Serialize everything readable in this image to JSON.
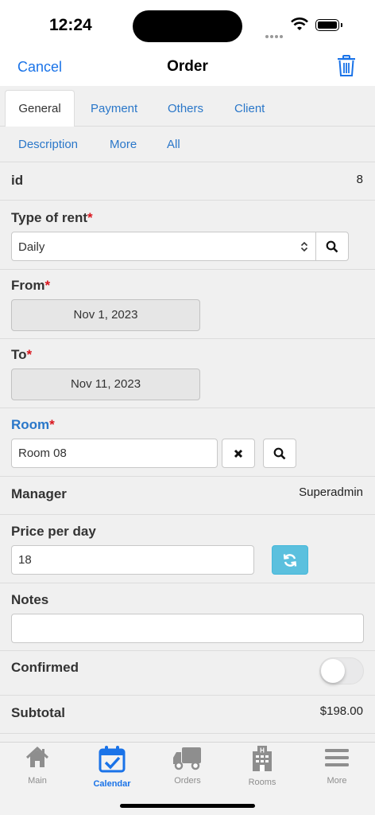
{
  "status_bar": {
    "time": "12:24"
  },
  "nav": {
    "cancel": "Cancel",
    "title": "Order",
    "delete_icon": "trash-icon"
  },
  "tabs": [
    {
      "label": "General",
      "active": true
    },
    {
      "label": "Payment"
    },
    {
      "label": "Others"
    },
    {
      "label": "Client"
    },
    {
      "label": "Description"
    },
    {
      "label": "More"
    },
    {
      "label": "All"
    }
  ],
  "form": {
    "id": {
      "label": "id",
      "value": "8"
    },
    "type_of_rent": {
      "label": "Type of rent",
      "required": "*",
      "value": "Daily"
    },
    "from": {
      "label": "From",
      "required": "*",
      "value": "Nov 1, 2023"
    },
    "to": {
      "label": "To",
      "required": "*",
      "value": "Nov 11, 2023"
    },
    "room": {
      "label": "Room",
      "required": "*",
      "value": "Room 08"
    },
    "manager": {
      "label": "Manager",
      "value": "Superadmin"
    },
    "price_per_day": {
      "label": "Price per day",
      "value": "18"
    },
    "notes": {
      "label": "Notes",
      "value": ""
    },
    "confirmed": {
      "label": "Confirmed",
      "on": false
    },
    "subtotal": {
      "label": "Subtotal",
      "value": "$198.00"
    }
  },
  "tab_bar": [
    {
      "label": "Main",
      "icon": "home-icon"
    },
    {
      "label": "Calendar",
      "icon": "calendar-icon",
      "active": true
    },
    {
      "label": "Orders",
      "icon": "truck-icon"
    },
    {
      "label": "Rooms",
      "icon": "hotel-icon"
    },
    {
      "label": "More",
      "icon": "menu-icon"
    }
  ],
  "colors": {
    "accent": "#1a73e8",
    "link": "#2a77c9",
    "required": "#d9141c",
    "refresh_button": "#5bc0de"
  }
}
